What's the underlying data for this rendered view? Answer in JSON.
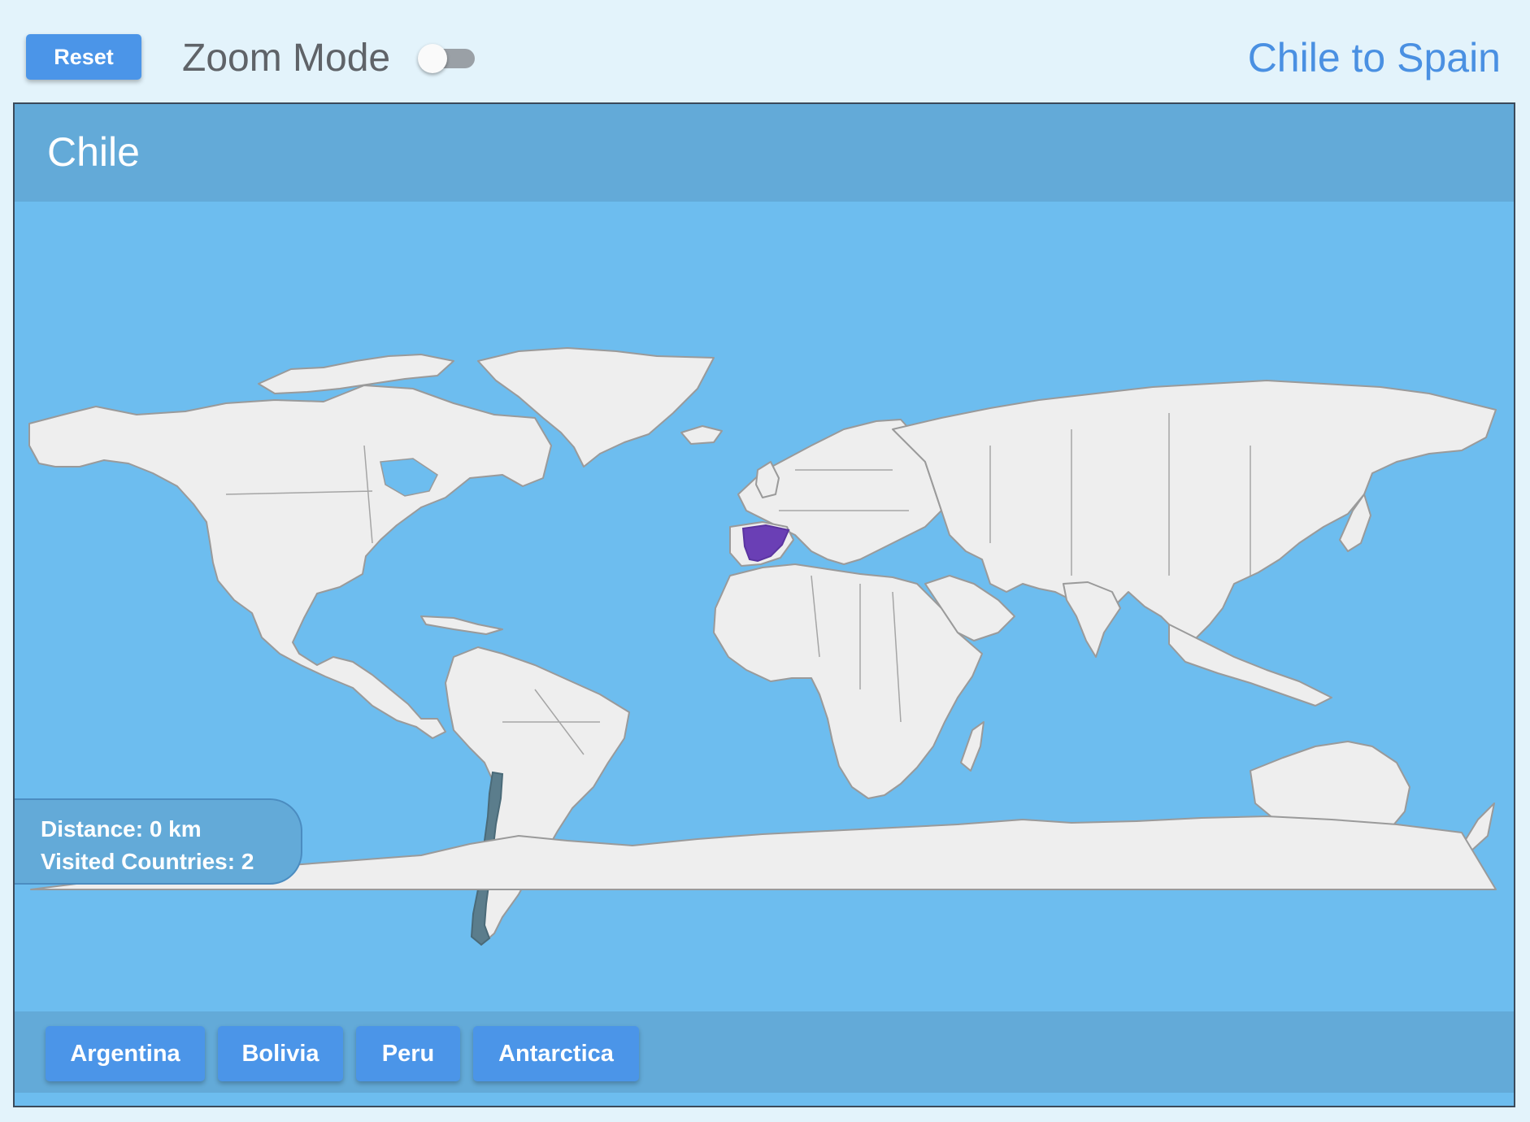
{
  "toolbar": {
    "reset_label": "Reset",
    "zoom_mode_label": "Zoom Mode",
    "zoom_mode_on": false,
    "route_title": "Chile to Spain"
  },
  "panel": {
    "current_country": "Chile",
    "distance_text": "Distance: 0 km",
    "visited_text": "Visited Countries: 2"
  },
  "map": {
    "highlighted_target": "Spain",
    "highlighted_current": "Chile",
    "colors": {
      "ocean": "#6dbdef",
      "land": "#eeeeee",
      "target": "#6a3fb5",
      "current": "#5b7d8c"
    }
  },
  "neighbors": [
    {
      "label": "Argentina"
    },
    {
      "label": "Bolivia"
    },
    {
      "label": "Peru"
    },
    {
      "label": "Antarctica"
    }
  ]
}
